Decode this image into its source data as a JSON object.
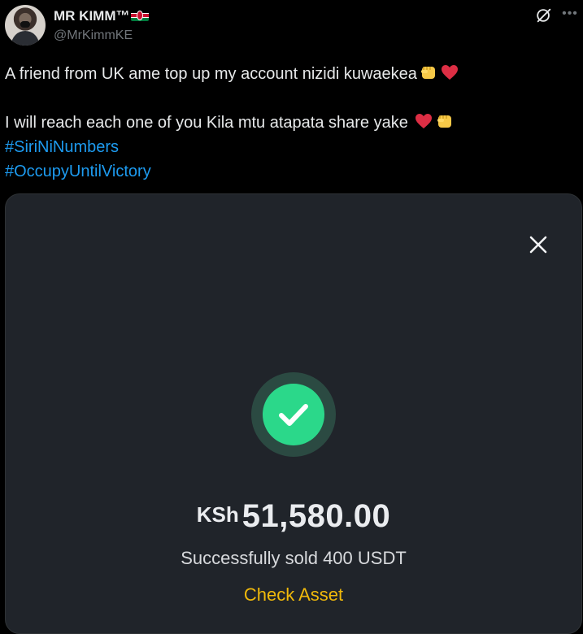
{
  "author": {
    "display_name": "MR KIMM™",
    "handle": "@MrKimmKE"
  },
  "tweet": {
    "line1": "A friend from UK ame top up my account nizidi kuwaekea",
    "line2": " I will reach each one of you Kila mtu atapata share yake",
    "hashtags": [
      "#SiriNiNumbers",
      "#OccupyUntilVictory"
    ]
  },
  "icons": {
    "avatar": "profile-avatar",
    "flag": "kenya-flag-icon",
    "grok": "grok-icon",
    "more": "more-icon",
    "close": "close-icon",
    "success": "checkmark-icon",
    "fist": "raised-fist-emoji",
    "heart": "red-heart-emoji"
  },
  "receipt": {
    "currency": "KSh",
    "amount": "51,580.00",
    "status": "Successfully sold 400 USDT",
    "action_label": "Check Asset"
  },
  "colors": {
    "background": "#000000",
    "text": "#e7e9ea",
    "muted": "#71767b",
    "link": "#1d9bf0",
    "card": "#20242a",
    "success": "#2bd88a",
    "accent": "#f0b90b"
  }
}
